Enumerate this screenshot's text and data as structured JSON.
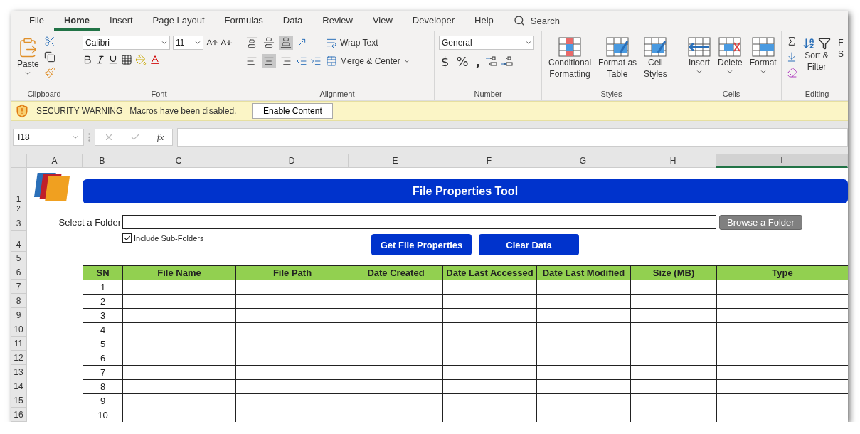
{
  "tabs": [
    {
      "label": "File",
      "selected": false
    },
    {
      "label": "Home",
      "selected": true
    },
    {
      "label": "Insert",
      "selected": false
    },
    {
      "label": "Page Layout",
      "selected": false
    },
    {
      "label": "Formulas",
      "selected": false
    },
    {
      "label": "Data",
      "selected": false
    },
    {
      "label": "Review",
      "selected": false
    },
    {
      "label": "View",
      "selected": false
    },
    {
      "label": "Developer",
      "selected": false
    },
    {
      "label": "Help",
      "selected": false
    }
  ],
  "search": {
    "placeholder": "Search"
  },
  "ribbon": {
    "clipboard": {
      "label": "Clipboard",
      "paste": "Paste"
    },
    "font": {
      "label": "Font",
      "name": "Calibri",
      "size": "11"
    },
    "alignment": {
      "label": "Alignment",
      "vertical": [
        {
          "selected": false
        },
        {
          "selected": false
        },
        {
          "selected": true
        }
      ],
      "horizontal": [
        {
          "selected": false
        },
        {
          "selected": true
        },
        {
          "selected": false
        }
      ],
      "wrap_text": "Wrap Text",
      "merge": "Merge & Center"
    },
    "number": {
      "label": "Number",
      "format": "General",
      "currency": "$",
      "percent": "%",
      "comma": ","
    },
    "styles": {
      "label": "Styles",
      "buttons": [
        {
          "label": "Conditional\nFormatting",
          "kind": "conditional"
        },
        {
          "label": "Format as\nTable",
          "kind": "table"
        },
        {
          "label": "Cell\nStyles",
          "kind": "cell"
        }
      ]
    },
    "cells": {
      "label": "Cells",
      "buttons": [
        {
          "label": "Insert",
          "kind": "insert"
        },
        {
          "label": "Delete",
          "kind": "delete"
        },
        {
          "label": "Format",
          "kind": "format"
        }
      ]
    },
    "editing": {
      "label": "Editing",
      "sort": "Sort &\nFilter",
      "cut_off": "F\nS"
    }
  },
  "security_bar": {
    "title": "SECURITY WARNING",
    "message": "Macros have been disabled.",
    "button": "Enable Content"
  },
  "formula_bar": {
    "name_box": "I18",
    "fx": "fx"
  },
  "sheet": {
    "columns": [
      {
        "letter": "A",
        "selected": false
      },
      {
        "letter": "B",
        "selected": false
      },
      {
        "letter": "C",
        "selected": false
      },
      {
        "letter": "D",
        "selected": false
      },
      {
        "letter": "E",
        "selected": false
      },
      {
        "letter": "F",
        "selected": false
      },
      {
        "letter": "G",
        "selected": false
      },
      {
        "letter": "H",
        "selected": false
      },
      {
        "letter": "I",
        "selected": true
      }
    ],
    "rows": [
      "1",
      "2",
      "3",
      "4",
      "5",
      "6",
      "7",
      "8",
      "9",
      "10",
      "11",
      "12",
      "13",
      "14",
      "15",
      "16"
    ],
    "title": "File Properties Tool",
    "folder_label": "Select a Folder",
    "browse_button": "Browse a Folder",
    "include_subfolders": {
      "label": "Include Sub-Folders",
      "checked": true
    },
    "buttons": [
      "Get File Properties",
      "Clear Data"
    ],
    "table": {
      "columns": [
        "SN",
        "File Name",
        "File Path",
        "Date Created",
        "Date Last Accessed",
        "Date Last Modified",
        "Size (MB)",
        "Type"
      ],
      "rows": [
        {
          "sn": "1"
        },
        {
          "sn": "2"
        },
        {
          "sn": "3"
        },
        {
          "sn": "4"
        },
        {
          "sn": "5"
        },
        {
          "sn": "6"
        },
        {
          "sn": "7"
        },
        {
          "sn": "8"
        },
        {
          "sn": "9"
        },
        {
          "sn": "10"
        }
      ]
    }
  }
}
